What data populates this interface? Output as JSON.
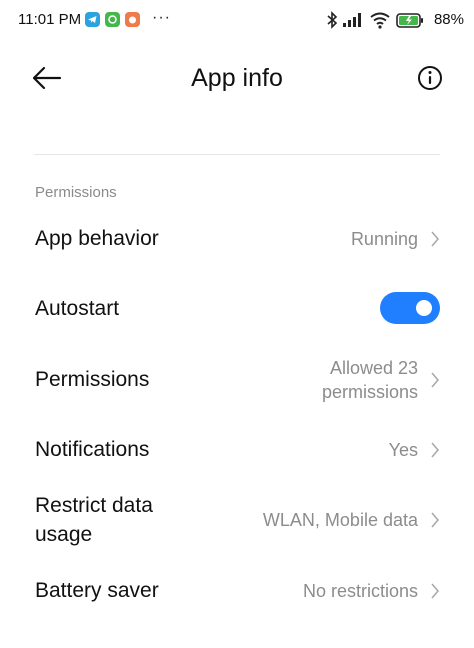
{
  "status_bar": {
    "time": "11:01 PM",
    "dots": "···",
    "battery": "88%",
    "icons": [
      "telegram-icon",
      "app-green-icon",
      "app-orange-icon",
      "bluetooth-icon",
      "signal-icon",
      "wifi-icon",
      "battery-icon"
    ],
    "colors": {
      "telegram": "#2aa3df",
      "green_app": "#43b74a",
      "orange_app": "#ef7a4a"
    }
  },
  "header": {
    "title": "App info",
    "back_icon": "arrow-left-icon",
    "info_icon": "info-icon"
  },
  "section": {
    "label": "Permissions"
  },
  "rows": {
    "app_behavior": {
      "title": "App behavior",
      "value": "Running"
    },
    "autostart": {
      "title": "Autostart",
      "enabled": true
    },
    "permissions": {
      "title": "Permissions",
      "value_line1": "Allowed 23",
      "value_line2": "permissions"
    },
    "notifications": {
      "title": "Notifications",
      "value": "Yes"
    },
    "restrict_data": {
      "title_line1": "Restrict data",
      "title_line2": "usage",
      "value": "WLAN, Mobile data"
    },
    "battery_saver": {
      "title": "Battery saver",
      "value": "No restrictions"
    }
  },
  "accent_color": "#1f7fff"
}
